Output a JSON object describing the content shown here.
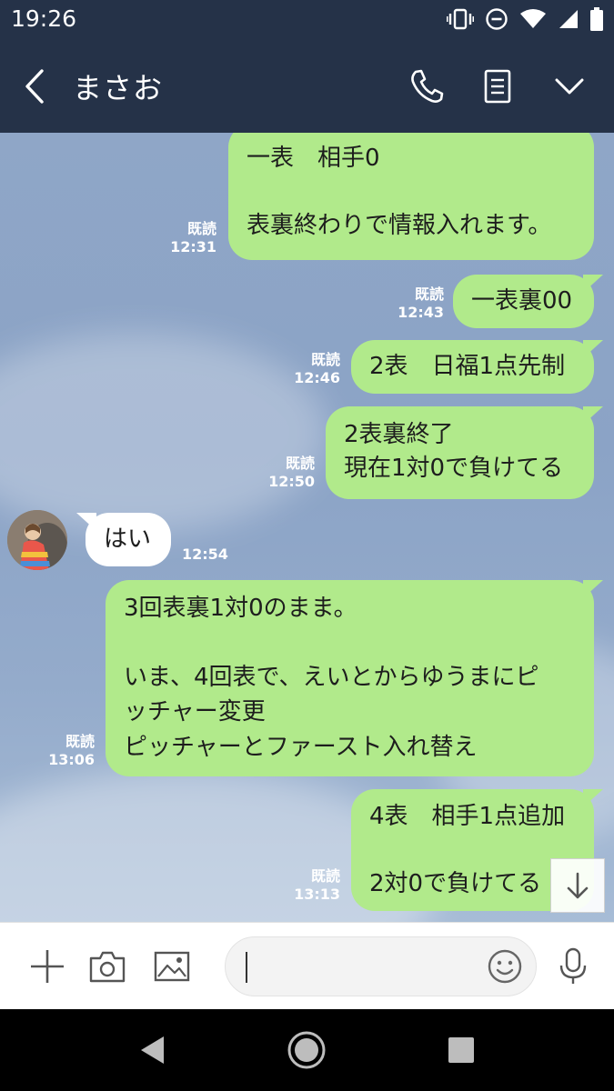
{
  "status_bar": {
    "time": "19:26",
    "icons": [
      "vibrate-icon",
      "dnd-icon",
      "wifi-icon",
      "cellular-icon",
      "battery-icon"
    ]
  },
  "header": {
    "contact_name": "まさお",
    "icons": [
      "back-icon",
      "phone-icon",
      "notes-icon",
      "chevron-down-icon"
    ]
  },
  "messages": [
    {
      "side": "out",
      "lines": [
        "一表　相手0",
        "",
        "表裏終わりで情報入れます。"
      ],
      "read": "既読",
      "time": "12:31"
    },
    {
      "side": "out",
      "lines": [
        "一表裏00"
      ],
      "read": "既読",
      "time": "12:43"
    },
    {
      "side": "out",
      "lines": [
        "2表　日福1点先制"
      ],
      "read": "既読",
      "time": "12:46"
    },
    {
      "side": "out",
      "lines": [
        "2表裏終了",
        "現在1対0で負けてる"
      ],
      "read": "既読",
      "time": "12:50"
    },
    {
      "side": "in",
      "lines": [
        "はい"
      ],
      "time": "12:54"
    },
    {
      "side": "out",
      "lines": [
        "3回表裏1対0のまま。",
        "",
        "いま、4回表で、えいとからゆうまにピ",
        "ッチャー変更",
        "ピッチャーとファースト入れ替え"
      ],
      "read": "既読",
      "time": "13:06"
    },
    {
      "side": "out",
      "lines": [
        "4表　相手1点追加",
        "",
        "2対0で負けてる"
      ],
      "read": "既読",
      "time": "13:13"
    }
  ],
  "input": {
    "placeholder": "",
    "icons": [
      "plus-icon",
      "camera-icon",
      "image-icon",
      "emoji-icon",
      "mic-icon"
    ]
  },
  "colors": {
    "header_bg": "#253248",
    "bubble_out": "#b1ea8b",
    "bubble_in": "#ffffff",
    "chat_bg": "#8fa6c7"
  }
}
